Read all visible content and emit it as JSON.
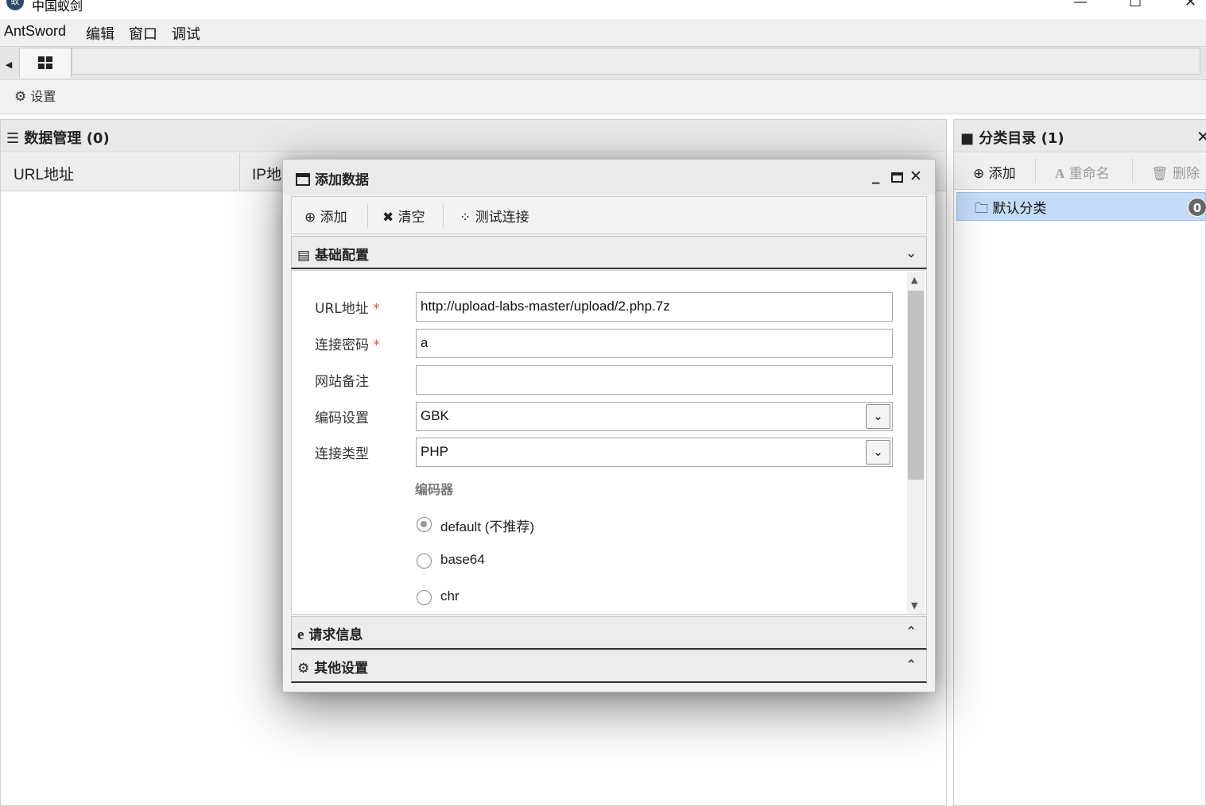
{
  "window": {
    "title": "中国蚁剑",
    "minimize": "—",
    "maximize": "☐",
    "close": "✕"
  },
  "menu": [
    "AntSword",
    "编辑",
    "窗口",
    "调试"
  ],
  "toolbar": {
    "settings_label": "设置"
  },
  "main": {
    "title": "数据管理 (0)",
    "columns": [
      "URL地址",
      "IP地"
    ]
  },
  "right": {
    "title": "分类目录 (1)",
    "add_label": "添加",
    "rename_label": "重命名",
    "delete_label": "删除",
    "category": {
      "label": "默认分类",
      "count": "0"
    }
  },
  "dialog": {
    "title": "添加数据",
    "toolbar": {
      "add_label": "添加",
      "clear_label": "清空",
      "test_label": "测试连接"
    },
    "section_basic": "基础配置",
    "section_request": "请求信息",
    "section_other": "其他设置",
    "fields": {
      "url_label": "URL地址",
      "url_value": "http://upload-labs-master/upload/2.php.7z",
      "password_label": "连接密码",
      "password_value": "a",
      "note_label": "网站备注",
      "note_value": "",
      "encoding_label": "编码设置",
      "encoding_value": "GBK",
      "type_label": "连接类型",
      "type_value": "PHP",
      "required_mark": "*"
    },
    "encoder": {
      "title": "编码器",
      "options": [
        "default (不推荐)",
        "base64",
        "chr"
      ],
      "selected": "default (不推荐)"
    }
  },
  "colors": {
    "selection": "#c5dcf8",
    "required": "#d9534f",
    "badge": "#666666"
  },
  "icons": [
    "app-logo-icon",
    "grid-icon",
    "gear-icon",
    "list-icon",
    "folder-icon",
    "close-icon",
    "plus-circle-icon",
    "font-a-icon",
    "trash-icon",
    "folder-outline-icon",
    "window-icon",
    "minimize-icon",
    "maximize-icon",
    "x-icon",
    "spinner-icon",
    "file-text-icon",
    "chevron-down-icon",
    "chevron-up-icon",
    "ie-icon",
    "gears-icon"
  ]
}
